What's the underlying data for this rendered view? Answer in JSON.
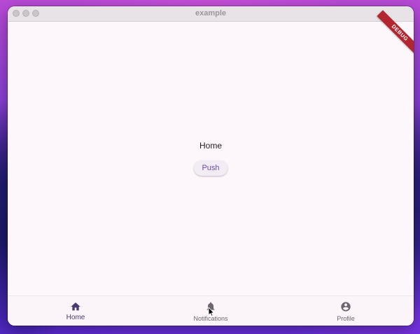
{
  "window": {
    "title": "example"
  },
  "debug_banner": "DEBUG",
  "main": {
    "text": "Home",
    "push_button": "Push"
  },
  "nav": {
    "items": [
      {
        "label": "Home",
        "icon": "home-icon",
        "selected": true
      },
      {
        "label": "Notifications",
        "icon": "bell-icon",
        "selected": false
      },
      {
        "label": "Profile",
        "icon": "account-circle-icon",
        "selected": false
      }
    ]
  },
  "colors": {
    "accent": "#4a3b73",
    "inactive": "#6b6670",
    "background": "#fdf7fb",
    "debug": "#b3262f"
  }
}
